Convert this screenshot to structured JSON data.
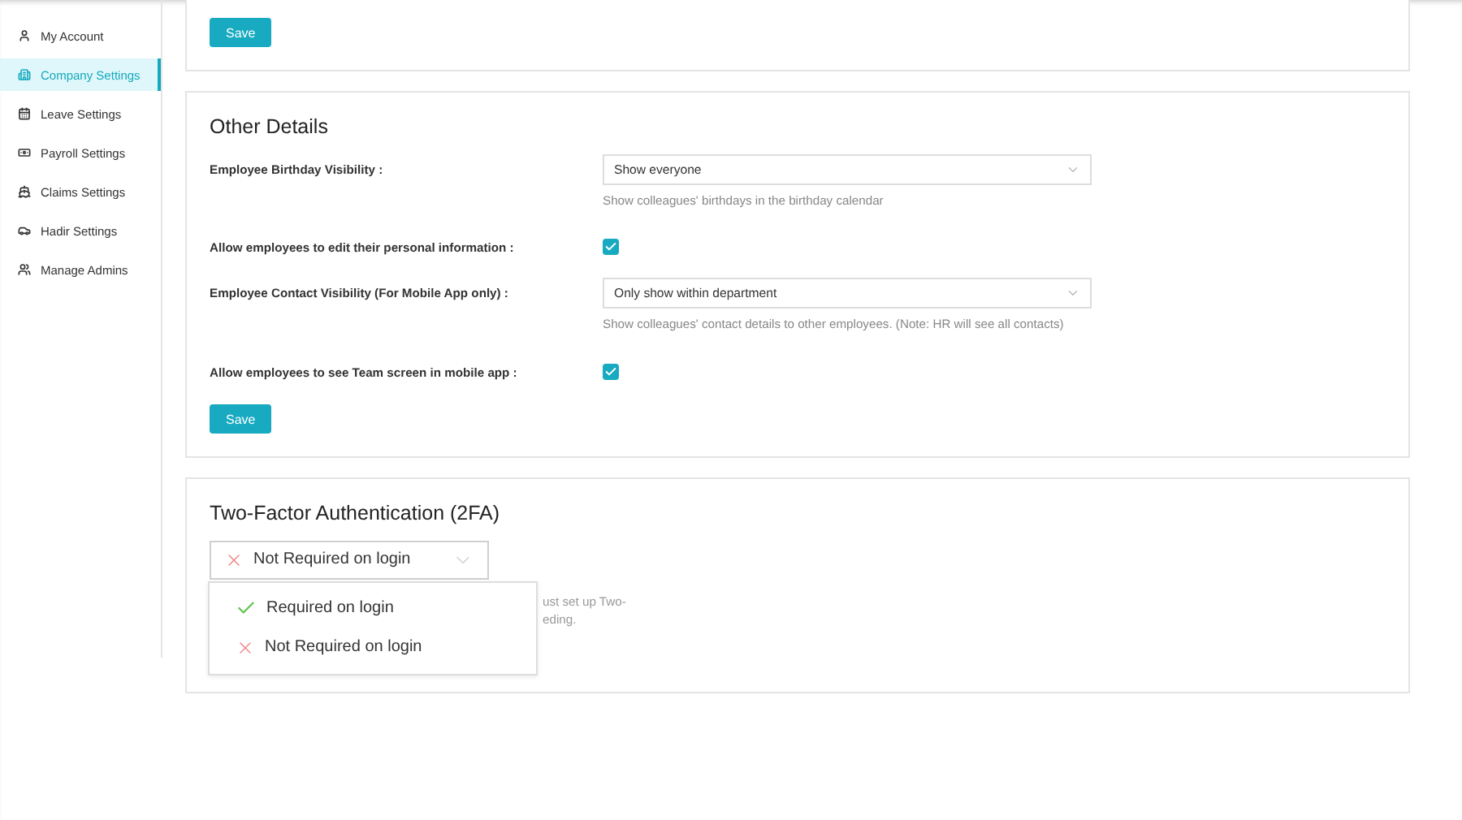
{
  "sidebar": {
    "items": [
      {
        "label": "My Account",
        "selected": false
      },
      {
        "label": "Company Settings",
        "selected": true
      },
      {
        "label": "Leave Settings",
        "selected": false
      },
      {
        "label": "Payroll Settings",
        "selected": false
      },
      {
        "label": "Claims Settings",
        "selected": false
      },
      {
        "label": "Hadir Settings",
        "selected": false
      },
      {
        "label": "Manage Admins",
        "selected": false
      }
    ]
  },
  "top_card": {
    "save_button": "Save"
  },
  "other_details": {
    "title": "Other Details",
    "fields": [
      {
        "kind": "select",
        "label": "Employee Birthday Visibility :",
        "value": "Show everyone",
        "hint": "Show colleagues' birthdays in the birthday calendar"
      },
      {
        "kind": "checkbox",
        "label": "Allow employees to edit their personal information :",
        "checked": true
      },
      {
        "kind": "select",
        "label": "Employee Contact Visibility (For Mobile App only) :",
        "value": "Only show within department",
        "hint": "Show colleagues' contact details to other employees. (Note: HR will see all contacts)"
      },
      {
        "kind": "checkbox",
        "label": "Allow employees to see Team screen in mobile app :",
        "checked": true
      }
    ],
    "save_button": "Save"
  },
  "two_factor": {
    "title": "Two-Factor Authentication (2FA)",
    "select": {
      "kind": "cross",
      "value": "Not Required on login",
      "expanded": true
    },
    "hint_lines": [
      "ust set up Two-",
      "eding."
    ],
    "options": [
      {
        "kind": "check",
        "label": "Required on login"
      },
      {
        "kind": "cross",
        "label": "Not Required on login"
      }
    ]
  }
}
